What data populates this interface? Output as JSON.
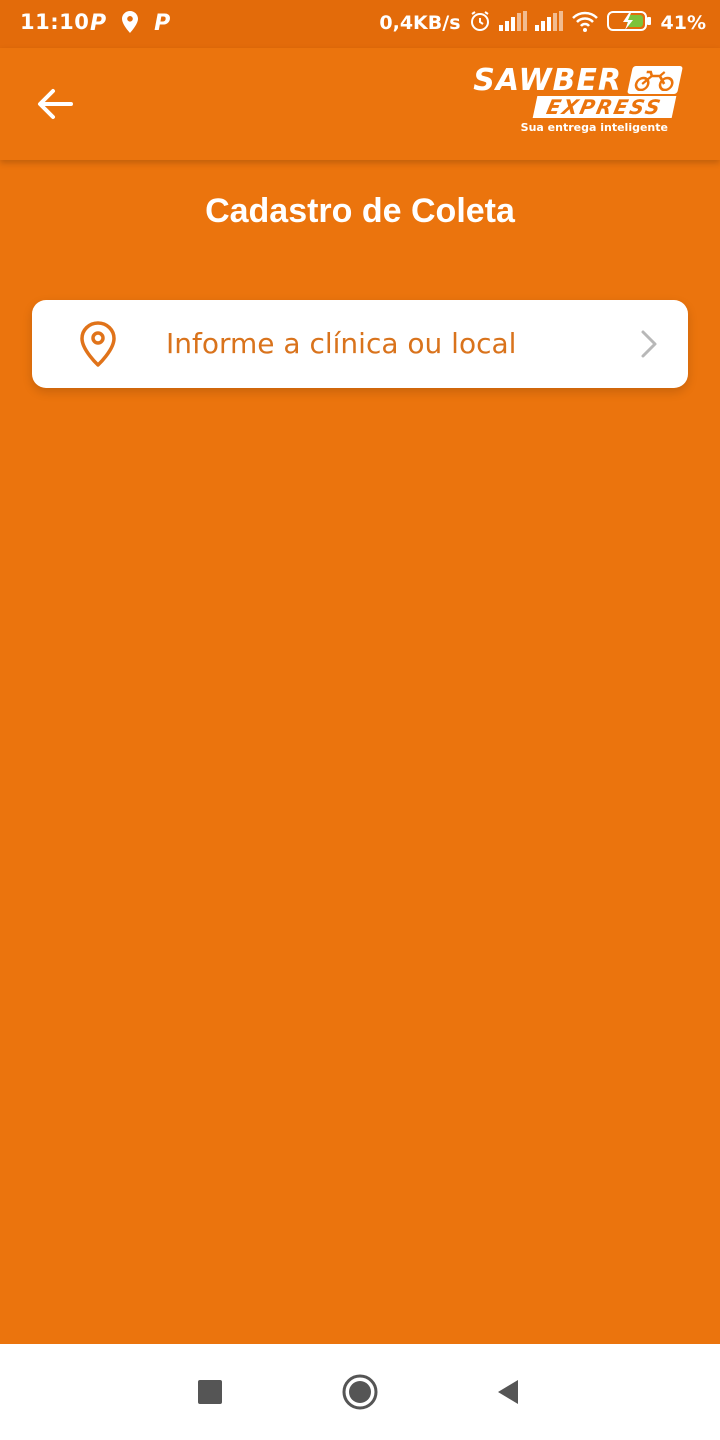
{
  "status_bar": {
    "time": "11:10",
    "left_icons": [
      "parking-icon",
      "location-icon",
      "parking-icon"
    ],
    "net_speed": "0,4KB/s",
    "right_icons": [
      "alarm-icon",
      "signal-icon",
      "signal-icon",
      "wifi-icon",
      "battery-charging-icon"
    ],
    "battery": "41%"
  },
  "app_bar": {
    "back_icon": "arrow-left-icon",
    "logo": {
      "line1": "SAWBER",
      "line2": "EXPRESS",
      "tagline": "Sua entrega inteligente",
      "icon": "motorcycle-icon"
    }
  },
  "page": {
    "title": "Cadastro de Coleta"
  },
  "location_field": {
    "icon": "location-pin-icon",
    "placeholder": "Informe a clínica ou local",
    "trailing_icon": "chevron-right-icon"
  },
  "nav_bar": {
    "buttons": [
      "recents-square-icon",
      "home-circle-icon",
      "back-triangle-icon"
    ]
  },
  "colors": {
    "primary": "#EB740D",
    "status_bar": "#E36B0A",
    "card": "#FFFFFF",
    "placeholder_text": "#D9731C"
  }
}
